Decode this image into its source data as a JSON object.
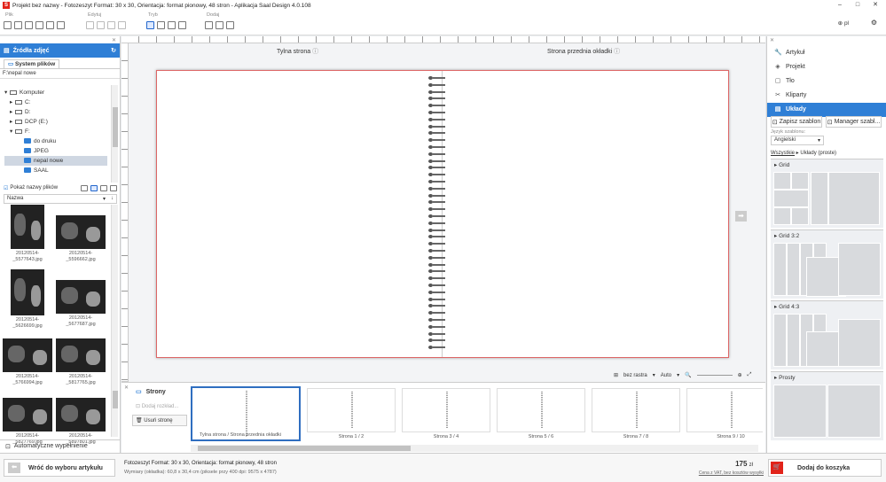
{
  "window": {
    "title": "Projekt bez nazwy - Fotozeszyt Format: 30 x 30, Orientacja: format pionowy, 48 stron - Aplikacja Saal Design 4.0.108",
    "controls": [
      "–",
      "□",
      "✕"
    ]
  },
  "toolbar": {
    "groups": [
      "Plik",
      "Edytuj",
      "Tryb",
      "Dodaj"
    ],
    "language": "pl"
  },
  "left_panel": {
    "header": "Źródła zdjęć",
    "tab": "System plików",
    "path": "F:\\nepal nowe",
    "tree": [
      {
        "label": "Komputer",
        "indent": 0,
        "type": "pc"
      },
      {
        "label": "C:",
        "indent": 1,
        "type": "drive"
      },
      {
        "label": "D:",
        "indent": 1,
        "type": "drive"
      },
      {
        "label": "DCP (E:)",
        "indent": 1,
        "type": "drive"
      },
      {
        "label": "F:",
        "indent": 1,
        "type": "drive"
      },
      {
        "label": "do druku",
        "indent": 2,
        "type": "folder"
      },
      {
        "label": "JPEG",
        "indent": 2,
        "type": "folder"
      },
      {
        "label": "nepal nowe",
        "indent": 2,
        "type": "folder",
        "selected": true
      },
      {
        "label": "SAAL",
        "indent": 2,
        "type": "folder"
      }
    ],
    "show_names_label": "Pokaż nazwy plików",
    "sort_label": "Nazwa",
    "thumbs": [
      {
        "name1": "20120514-",
        "name2": "_5577643.jpg"
      },
      {
        "name1": "20120514-",
        "name2": "_5596662.jpg"
      },
      {
        "name1": "20120514-",
        "name2": "_5626699.jpg"
      },
      {
        "name1": "20120514-",
        "name2": "_5677687.jpg"
      },
      {
        "name1": "20120514-",
        "name2": "_5766994.jpg"
      },
      {
        "name1": "20120514-",
        "name2": "_5817765.jpg"
      },
      {
        "name1": "20120514-",
        "name2": "_5827769.jpg"
      },
      {
        "name1": "20120514-",
        "name2": "_5897801.jpg"
      }
    ],
    "autofill": "Automatyczne wypełnienie"
  },
  "canvas": {
    "left_label": "Tylna strona",
    "right_label": "Strona przednia okładki",
    "grid_label": "bez rastra",
    "zoom_label": "Auto"
  },
  "pages_panel": {
    "title": "Strony",
    "add_spread": "Dodaj rozkład...",
    "delete_page": "Usuń stronę",
    "pages": [
      "Tylna strona / Strona przednia okładki",
      "Strona 1 / 2",
      "Strona 3 / 4",
      "Strona 5 / 6",
      "Strona 7 / 8",
      "Strona 9 / 10"
    ]
  },
  "right_panel": {
    "menu": [
      {
        "label": "Artykuł",
        "icon": "🔧"
      },
      {
        "label": "Projekt",
        "icon": "◈"
      },
      {
        "label": "Tło",
        "icon": "▢"
      },
      {
        "label": "Kliparty",
        "icon": "✂"
      },
      {
        "label": "Układy",
        "icon": "▤",
        "active": true
      }
    ],
    "save_template": "Zapisz szablon",
    "manager_template": "Manager szabl...",
    "template_lang_label": "Język szablonu:",
    "template_lang_value": "Angielski",
    "breadcrumb_all": "Wszystkie",
    "breadcrumb_current": "Układy (proste)",
    "sections": [
      "Grid",
      "Grid 3:2",
      "Grid 4:3",
      "Prosty"
    ]
  },
  "status": {
    "back_button": "Wróć do wyboru artykułu",
    "product_line1": "Fotozeszyt Format: 30 x 30, Orientacja: format pionowy, 48 stron",
    "product_line2": "Wymiary (okładka): 60,8 x 30,4 cm (piksele przy 400 dpi: 9575 x 4787)",
    "price": "175",
    "currency": "zł",
    "price_note": "Cena z VAT, bez kosztów wysyłki",
    "cart_button": "Dodaj do koszyka"
  },
  "colors": {
    "accent": "#2f7fd6",
    "cart": "#e2231a"
  }
}
